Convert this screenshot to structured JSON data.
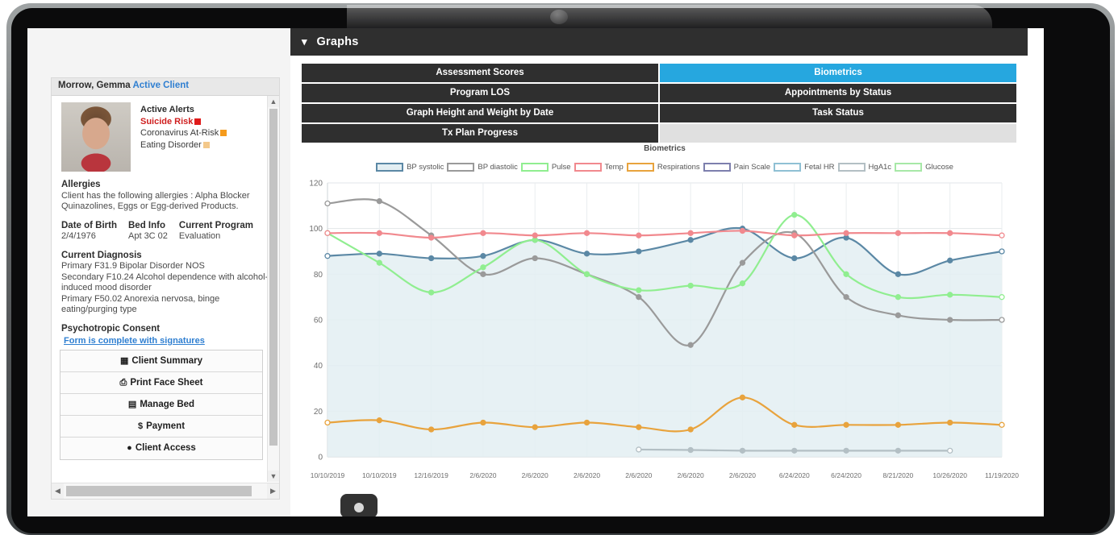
{
  "client_card": {
    "name": "Morrow, Gemma",
    "status": "Active Client",
    "alerts_title": "Active Alerts",
    "alerts": [
      {
        "label": "Suicide Risk",
        "color": "#e01b1b",
        "severe": true
      },
      {
        "label": "Coronavirus At-Risk",
        "color": "#f59b1c",
        "severe": false
      },
      {
        "label": "Eating Disorder",
        "color": "#f3c88a",
        "severe": false
      }
    ],
    "allergies_title": "Allergies",
    "allergies_text": "Client has the following allergies : Alpha Blocker Quinazolines, Eggs or Egg-derived Products.",
    "dob_label": "Date of Birth",
    "dob_value": "2/4/1976",
    "bed_label": "Bed Info",
    "bed_value": "Apt 3C 02",
    "program_label": "Current Program",
    "program_value": "Evaluation",
    "diagnosis_title": "Current Diagnosis",
    "diagnosis_lines": [
      "Primary F31.9 Bipolar Disorder NOS",
      "Secondary F10.24 Alcohol dependence with alcohol-induced mood disorder",
      "Primary F50.02 Anorexia nervosa, binge eating/purging type"
    ],
    "consent_title": "Psychotropic Consent",
    "consent_link": "Form is complete with signatures",
    "refresh_icon": "refresh-icon",
    "buttons": [
      {
        "label": "Client Summary",
        "icon": "grid-icon",
        "glyph": "▥"
      },
      {
        "label": "Print Face Sheet",
        "icon": "printer-icon",
        "glyph": "⎙"
      },
      {
        "label": "Manage Bed",
        "icon": "bed-icon",
        "glyph": "⛱"
      },
      {
        "label": "Payment",
        "icon": "dollar-icon",
        "glyph": "$"
      },
      {
        "label": "Client Access",
        "icon": "user-gear-icon",
        "glyph": "👤"
      }
    ]
  },
  "header": {
    "title": "Graphs",
    "chevron": "chevron-down-icon"
  },
  "tabs": {
    "rows": [
      [
        {
          "label": "Assessment Scores",
          "selected": false
        },
        {
          "label": "Biometrics",
          "selected": true
        }
      ],
      [
        {
          "label": "Program LOS",
          "selected": false
        },
        {
          "label": "Appointments by Status",
          "selected": false
        }
      ],
      [
        {
          "label": "Graph Height and Weight by Date",
          "selected": false
        },
        {
          "label": "Task Status",
          "selected": false
        }
      ],
      [
        {
          "label": "Tx Plan Progress",
          "selected": false
        },
        {
          "label": "",
          "selected": false,
          "empty": true
        }
      ]
    ],
    "selected_color": "#26a7df",
    "tab_color": "#2f2f2f"
  },
  "chart_data": {
    "type": "line",
    "title": "Biometrics",
    "xlabel": "",
    "ylabel": "",
    "ylim": [
      0,
      120
    ],
    "yticks": [
      0,
      20,
      40,
      60,
      80,
      100,
      120
    ],
    "grid": true,
    "legend_position": "top",
    "categories": [
      "10/10/2019",
      "10/10/2019",
      "12/16/2019",
      "2/6/2020",
      "2/6/2020",
      "2/6/2020",
      "2/6/2020",
      "2/6/2020",
      "2/6/2020",
      "6/24/2020",
      "6/24/2020",
      "8/21/2020",
      "10/26/2020",
      "11/19/2020"
    ],
    "series": [
      {
        "name": "BP systolic",
        "color": "#5b88a5",
        "fill": "#e3eef2",
        "values": [
          88,
          89,
          87,
          88,
          95,
          89,
          90,
          95,
          100,
          87,
          96,
          80,
          86,
          90
        ]
      },
      {
        "name": "BP diastolic",
        "color": "#9a9a9a",
        "fill": null,
        "values": [
          111,
          112,
          97,
          80,
          87,
          80,
          70,
          49,
          85,
          98,
          70,
          62,
          60,
          60
        ]
      },
      {
        "name": "Pulse",
        "color": "#90ee90",
        "fill": null,
        "values": [
          98,
          85,
          72,
          83,
          95,
          80,
          73,
          75,
          76,
          106,
          80,
          70,
          71,
          70
        ]
      },
      {
        "name": "Temp",
        "color": "#f1898e",
        "fill": null,
        "values": [
          98,
          98,
          96,
          98,
          97,
          98,
          97,
          98,
          99,
          97,
          98,
          98,
          98,
          97
        ]
      },
      {
        "name": "Respirations",
        "color": "#e8a33d",
        "fill": null,
        "values": [
          15,
          16,
          12,
          15,
          13,
          15,
          13,
          12,
          26,
          14,
          14,
          14,
          15,
          14
        ]
      },
      {
        "name": "Pain Scale",
        "color": "#7d7fad",
        "fill": null,
        "values": []
      },
      {
        "name": "Fetal HR",
        "color": "#8fc0d4",
        "fill": null,
        "values": []
      },
      {
        "name": "HgA1c",
        "color": "#b3bfc4",
        "fill": null,
        "values": [
          null,
          null,
          null,
          null,
          null,
          null,
          3.2,
          3.0,
          2.7,
          2.7,
          2.7,
          2.7,
          2.7,
          null
        ]
      },
      {
        "name": "Glucose",
        "color": "#a7e8a7",
        "fill": null,
        "values": []
      }
    ]
  },
  "fab": {
    "name": "chat-fab"
  }
}
